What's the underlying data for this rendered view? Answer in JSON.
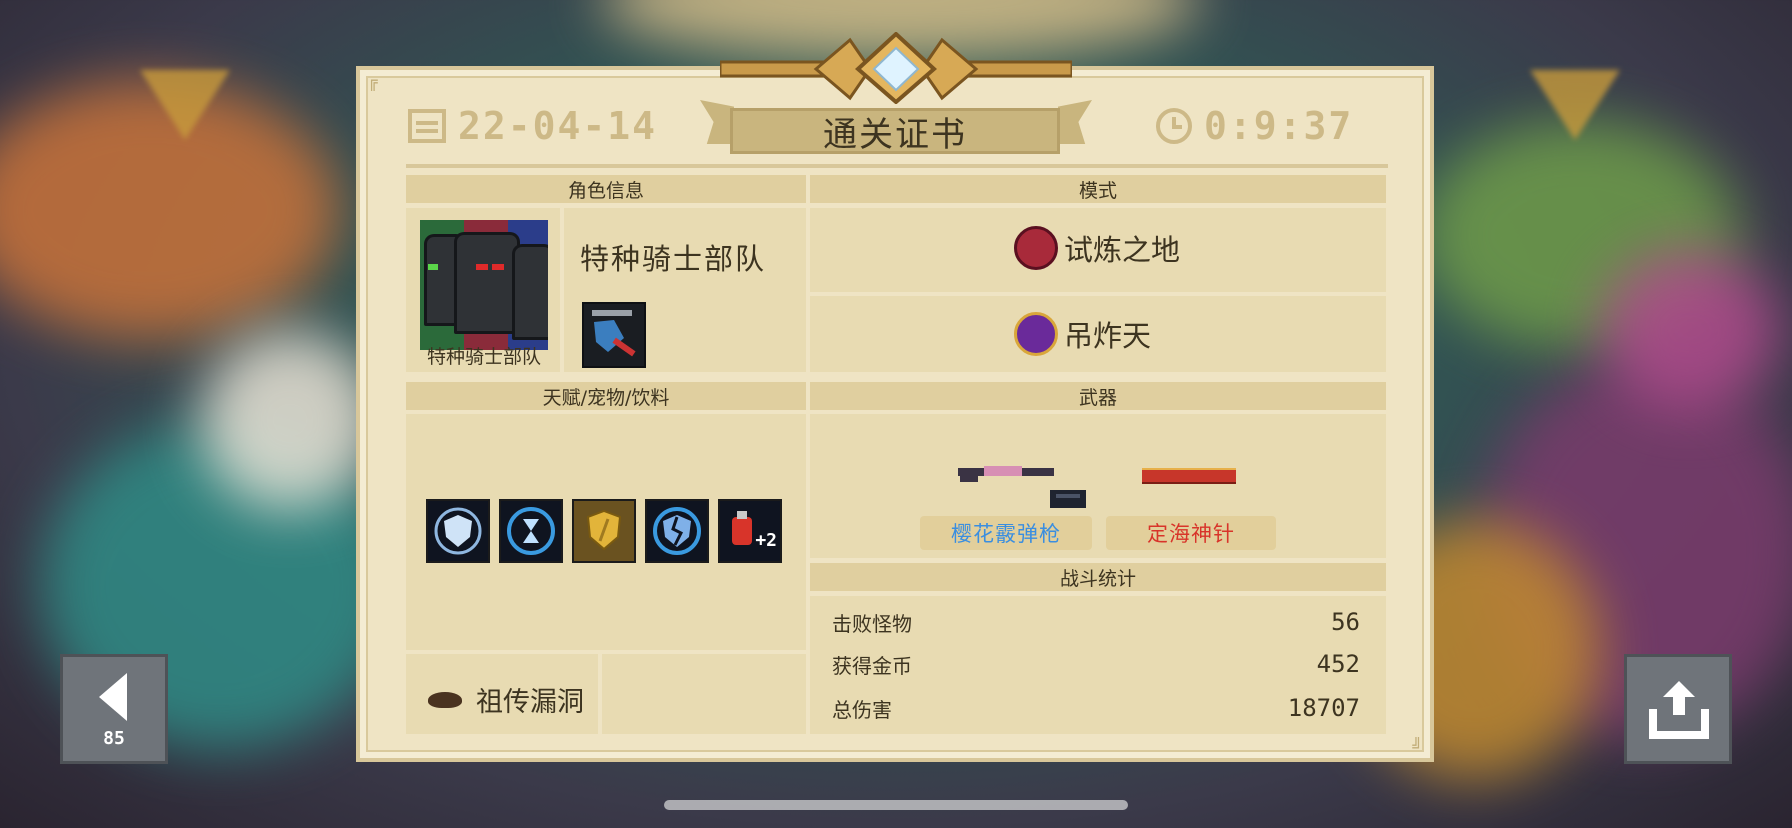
{
  "certificate": {
    "title": "通关证书",
    "date": "22-04-14",
    "time": "0:9:37"
  },
  "character": {
    "section_label": "角色信息",
    "name": "特种骑士部队",
    "portrait_label": "特种骑士部队"
  },
  "mode": {
    "section_label": "模式",
    "primary": "试炼之地",
    "secondary": "吊炸天"
  },
  "talents": {
    "section_label": "天赋/宠物/饮料",
    "icons": [
      "shield-buff-icon",
      "hourglass-buff-icon",
      "golden-shield-buff-icon",
      "broken-shield-buff-icon",
      "red-potion-plus2-icon"
    ],
    "potion_badge": "+2",
    "legacy_bug": "祖传漏洞"
  },
  "weapons": {
    "section_label": "武器",
    "items": [
      {
        "name": "樱花霰弹枪",
        "color": "#3a8ee0"
      },
      {
        "name": "定海神针",
        "color": "#d8342a"
      }
    ]
  },
  "battle_stats": {
    "section_label": "战斗统计",
    "rows": [
      {
        "label": "击败怪物",
        "value": "56"
      },
      {
        "label": "获得金币",
        "value": "452"
      },
      {
        "label": "总伤害",
        "value": "18707"
      }
    ]
  },
  "controls": {
    "back_count": "85"
  }
}
